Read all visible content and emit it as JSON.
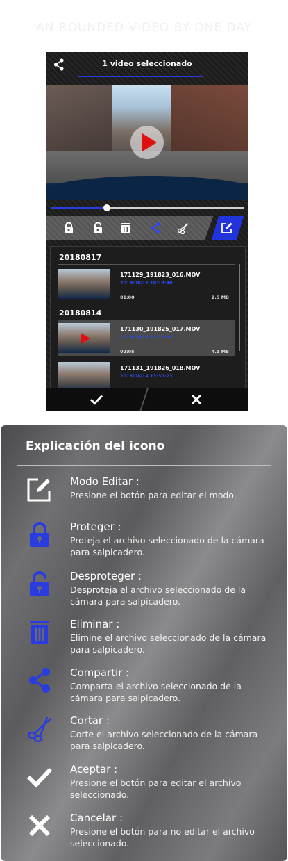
{
  "faded_title": "AN ROUNDED VIDEO BY ONE DAY",
  "phone": {
    "title": "1 video seleccionado",
    "progress_fraction": 0.29,
    "groups": [
      {
        "date": "20180817",
        "files": [
          {
            "name": "171129_191823_016.MOV",
            "date": "2018/08/17  18:19:40",
            "duration": "01:00",
            "size": "2.5 MB",
            "selected": false
          }
        ]
      },
      {
        "date": "20180814",
        "files": [
          {
            "name": "171130_191825_017.MOV",
            "date": "2018/08/14  12:15:33",
            "duration": "02:05",
            "size": "4.1 MB",
            "selected": true
          },
          {
            "name": "171131_191826_018.MOV",
            "date": "2018/08/14  13:30:23",
            "duration": "",
            "size": "",
            "selected": false
          }
        ]
      }
    ]
  },
  "panel": {
    "title": "Explicación del icono",
    "items": [
      {
        "icon": "edit-icon",
        "name": "Modo Editar :",
        "desc": "Presione el botón para editar el modo."
      },
      {
        "icon": "lock-icon",
        "name": "Proteger :",
        "desc": "Proteja el archivo seleccionado de la cámara para salpicadero."
      },
      {
        "icon": "unlock-icon",
        "name": "Desproteger :",
        "desc": "Desproteja el archivo seleccionado de la cámara para salpicadero."
      },
      {
        "icon": "trash-icon",
        "name": "Eliminar :",
        "desc": "Elimine el archivo seleccionado de la cámara para salpicadero."
      },
      {
        "icon": "share-icon",
        "name": "Compartir :",
        "desc": "Comparta el archivo seleccionado de la cámara para salpicadero."
      },
      {
        "icon": "scissors-icon",
        "name": "Cortar :",
        "desc": "Corte el archivo seleccionado de la cámara para salpicadero."
      },
      {
        "icon": "check-icon",
        "name": "Aceptar :",
        "desc": "Presione el botón para editar el archivo seleccionado."
      },
      {
        "icon": "close-icon",
        "name": "Cancelar :",
        "desc": "Presione el botón para no editar el archivo seleccionado."
      }
    ]
  },
  "colors": {
    "accent": "#2a3be0",
    "play": "#e01010"
  }
}
